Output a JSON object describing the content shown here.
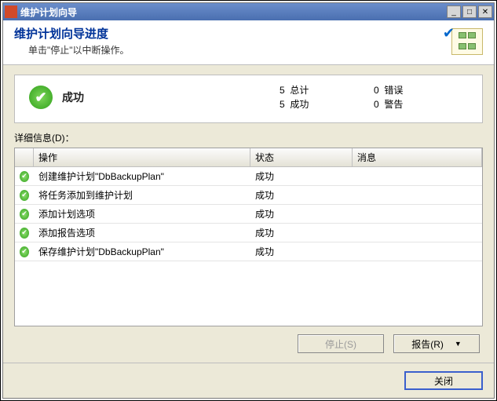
{
  "window": {
    "title": "维护计划向导"
  },
  "header": {
    "title": "维护计划向导进度",
    "subtitle": "单击\"停止\"以中断操作。"
  },
  "status": {
    "label": "成功",
    "totalCount": "5",
    "totalLabel": "总计",
    "successCount": "5",
    "successLabel": "成功",
    "errorCount": "0",
    "errorLabel": "错误",
    "warnCount": "0",
    "warnLabel": "警告"
  },
  "details": {
    "label": "详细信息(D)："
  },
  "columns": {
    "op": "操作",
    "state": "状态",
    "msg": "消息"
  },
  "rows": [
    {
      "op": "创建维护计划\"DbBackupPlan\"",
      "state": "成功",
      "msg": ""
    },
    {
      "op": "将任务添加到维护计划",
      "state": "成功",
      "msg": ""
    },
    {
      "op": "添加计划选项",
      "state": "成功",
      "msg": ""
    },
    {
      "op": "添加报告选项",
      "state": "成功",
      "msg": ""
    },
    {
      "op": "保存维护计划\"DbBackupPlan\"",
      "state": "成功",
      "msg": ""
    }
  ],
  "buttons": {
    "stop": "停止(S)",
    "report": "报告(R)",
    "close": "关闭"
  }
}
